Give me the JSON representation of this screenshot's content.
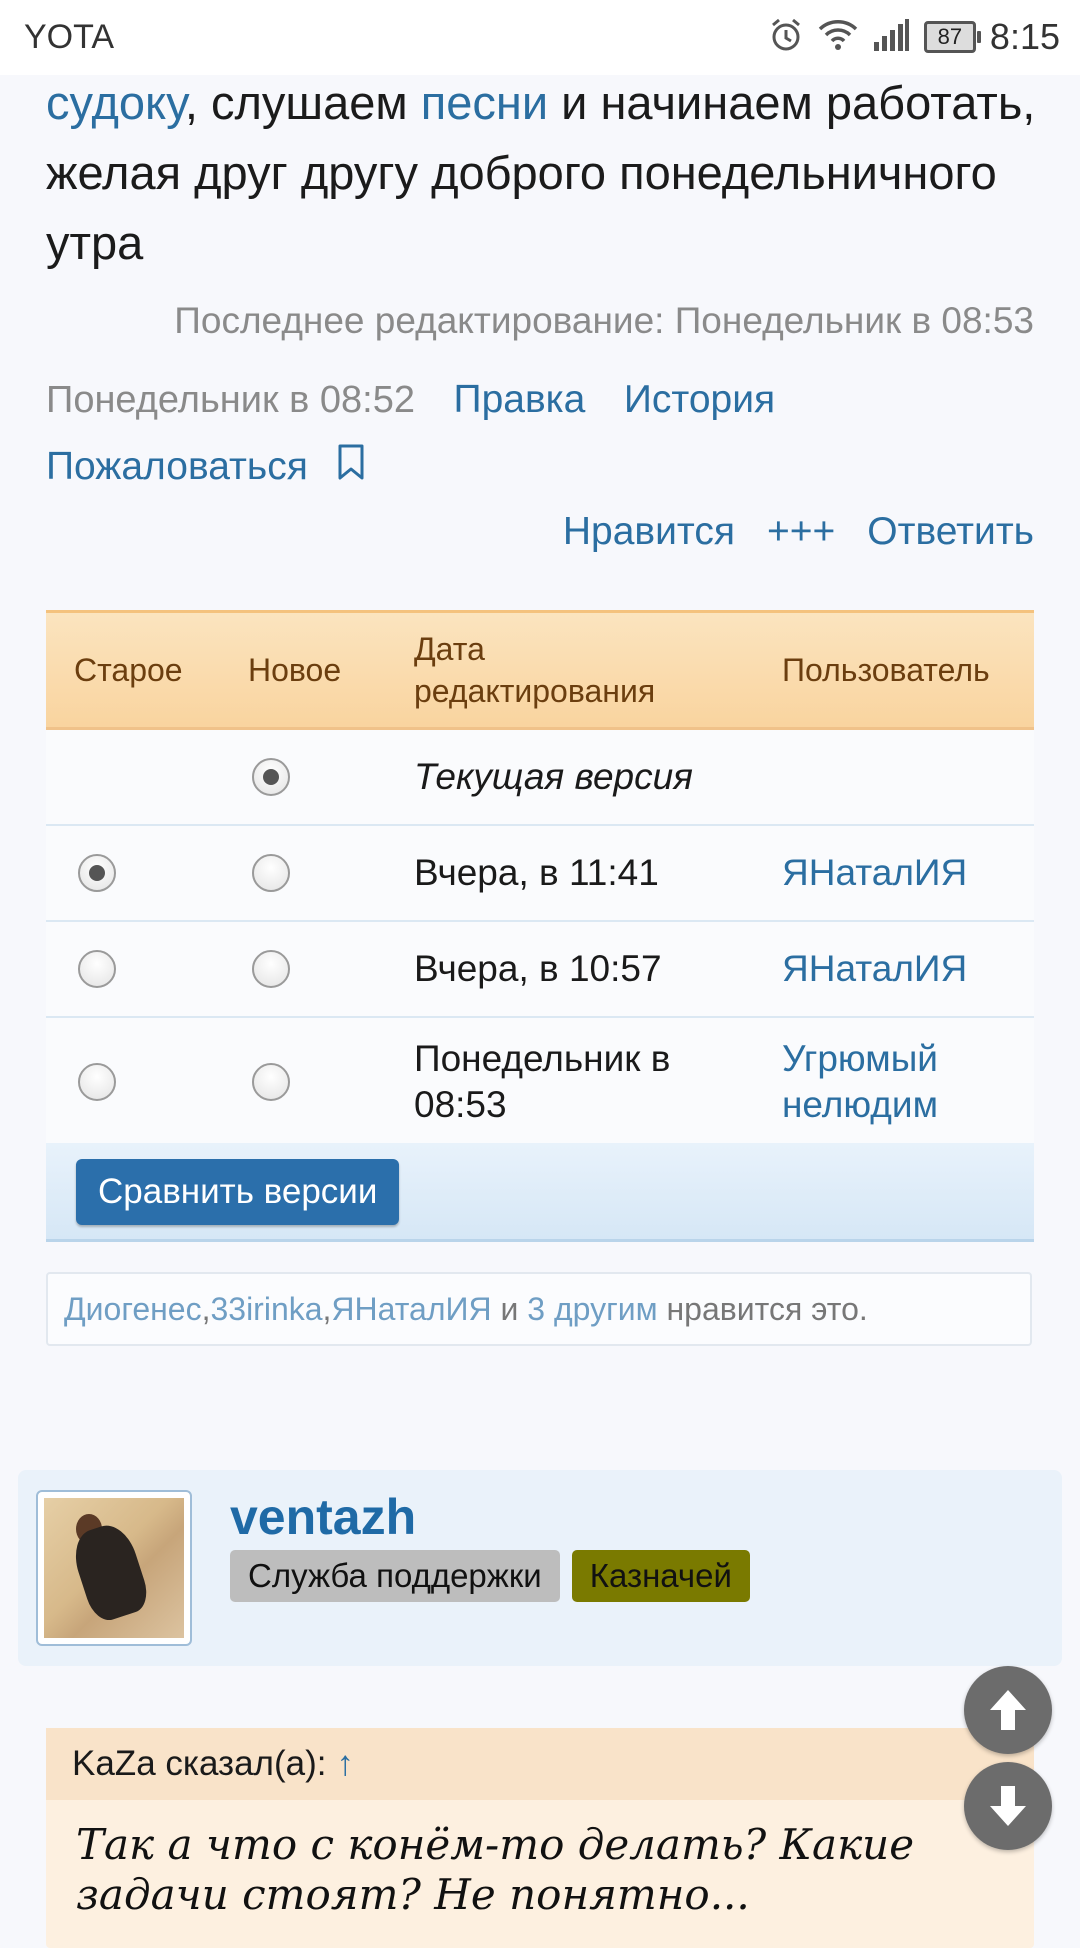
{
  "status_bar": {
    "carrier": "YOTA",
    "battery": "87",
    "time": "8:15"
  },
  "post": {
    "text_parts": [
      {
        "text": "судоку",
        "link": true
      },
      {
        "text": ", слушаем ",
        "link": false
      },
      {
        "text": "песни",
        "link": true
      },
      {
        "text": " и начинаем работать, желая друг другу доброго понедельничного утра",
        "link": false
      }
    ],
    "last_edit": "Последнее редактирование: Понедельник в 08:53",
    "date": "Понедельник в 08:52",
    "edit_link": "Правка",
    "history_link": "История",
    "report_link": "Пожаловаться",
    "like_link": "Нравится",
    "plus_link": "+++",
    "reply_link": "Ответить"
  },
  "history_table": {
    "headers": {
      "old": "Старое",
      "new": "Новое",
      "date": "Дата редактирования",
      "user": "Пользователь"
    },
    "rows": [
      {
        "date": "Текущая версия",
        "user": "",
        "old_radio": false,
        "new_radio": true,
        "show_old": false,
        "current": true
      },
      {
        "date": "Вчера, в 11:41",
        "user": "ЯНаталИЯ",
        "old_radio": true,
        "new_radio": false,
        "show_old": true,
        "current": false
      },
      {
        "date": "Вчера, в 10:57",
        "user": "ЯНаталИЯ",
        "old_radio": false,
        "new_radio": false,
        "show_old": true,
        "current": false
      },
      {
        "date": "Понедельник в 08:53",
        "user": "Угрюмый нелюдим",
        "old_radio": false,
        "new_radio": false,
        "show_old": true,
        "current": false
      }
    ],
    "compare_button": "Сравнить версии"
  },
  "likes": {
    "users": [
      "Диогенес",
      "33irinka",
      "ЯНаталИЯ"
    ],
    "sep": ", ",
    "and": " и ",
    "others": "3 другим",
    "suffix": " нравится это."
  },
  "next_post": {
    "username": "ventazh",
    "badges": [
      {
        "label": "Служба поддержки",
        "kind": "support"
      },
      {
        "label": "Казначей",
        "kind": "treasurer"
      }
    ],
    "quote": {
      "author_line": "KaZa сказал(а):",
      "arrow": "↑",
      "text": "Так а что с конём-то делать? Какие задачи стоят? Не понятно..."
    }
  },
  "icons": [
    "alarm-icon",
    "wifi-icon",
    "signal-icon",
    "battery-icon",
    "bookmark-icon",
    "scroll-up-icon",
    "scroll-down-icon"
  ]
}
